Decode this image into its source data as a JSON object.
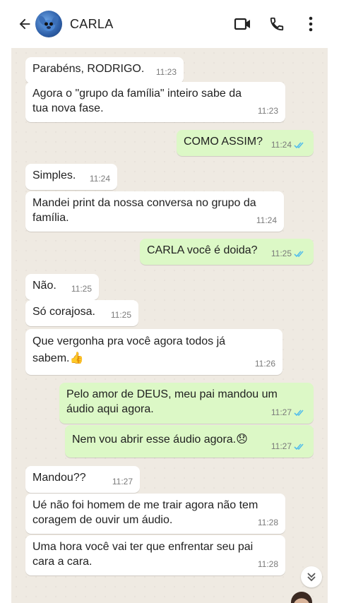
{
  "header": {
    "contact_name": "CARLA",
    "icons": {
      "back": "arrow-left-icon",
      "video": "video-camera-icon",
      "call": "phone-icon",
      "menu": "more-vertical-icon"
    }
  },
  "messages": [
    {
      "dir": "in",
      "text": "Parabéns, RODRIGO.",
      "time": "11:23"
    },
    {
      "dir": "in",
      "text": "Agora o \"grupo da família\" inteiro sabe da\ntua nova fase.",
      "time": "11:23"
    },
    {
      "dir": "out",
      "text": "COMO ASSIM?",
      "time": "11:24",
      "read": true
    },
    {
      "dir": "in",
      "text": "Simples.",
      "time": "11:24"
    },
    {
      "dir": "in",
      "text": "Mandei print da nossa conversa no grupo da\nfamília.",
      "time": "11:24"
    },
    {
      "dir": "out",
      "text": "CARLA você é doida?",
      "time": "11:25",
      "read": true
    },
    {
      "dir": "in",
      "text": "Não.",
      "time": "11:25"
    },
    {
      "dir": "in",
      "text": "Só corajosa.",
      "time": "11:25"
    },
    {
      "dir": "in",
      "text": "Que vergonha pra você agora todos já\nsabem.👍",
      "time": "11:26"
    },
    {
      "dir": "out",
      "text": "Pelo amor de DEUS, meu pai mandou um\náudio aqui agora.",
      "time": "11:27",
      "read": true
    },
    {
      "dir": "out",
      "text": "Nem vou abrir esse áudio agora.😞",
      "time": "11:27",
      "read": true
    },
    {
      "dir": "in",
      "text": "Mandou??",
      "time": "11:27"
    },
    {
      "dir": "in",
      "text": "Ué não foi homem de me trair agora não tem\ncoragem de ouvir um áudio.",
      "time": "11:28"
    },
    {
      "dir": "in",
      "text": "Uma hora você vai ter que enfrentar seu pai\ncara a cara.",
      "time": "11:28"
    }
  ],
  "colors": {
    "incoming": "#ffffff",
    "outgoing": "#dcf8c6",
    "chat_bg": "#efeae2",
    "read_ticks": "#53bdeb"
  }
}
